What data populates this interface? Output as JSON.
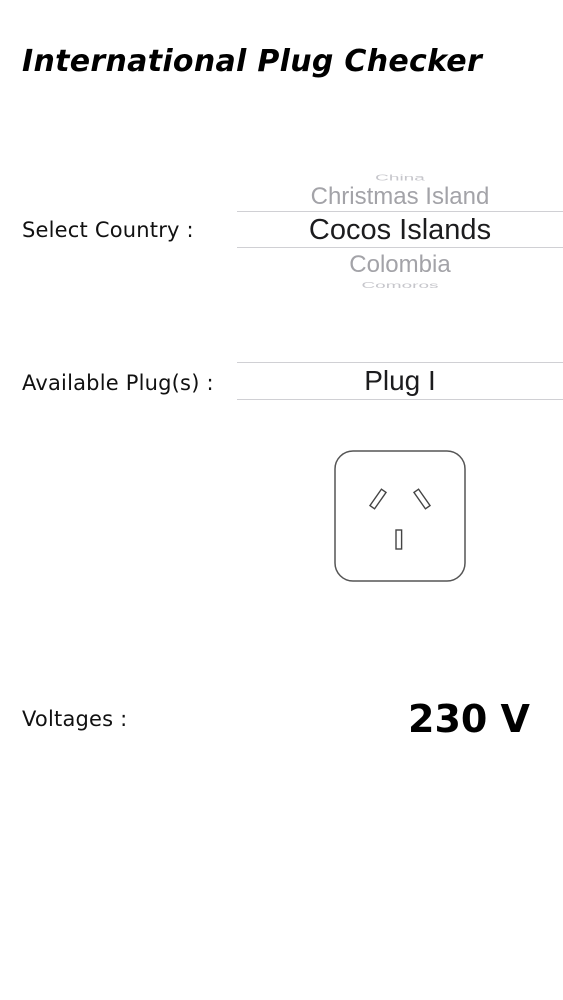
{
  "app": {
    "title": "International Plug Checker"
  },
  "country_select": {
    "label": "Select Country :",
    "options": [
      "China",
      "Christmas Island",
      "Cocos Islands",
      "Colombia",
      "Comoros"
    ],
    "selected": "Cocos Islands"
  },
  "plug": {
    "label": "Available Plug(s) :",
    "value": "Plug I",
    "icon": "plug-type-i-socket-icon"
  },
  "voltage": {
    "label": "Voltages :",
    "value": "230 V"
  }
}
